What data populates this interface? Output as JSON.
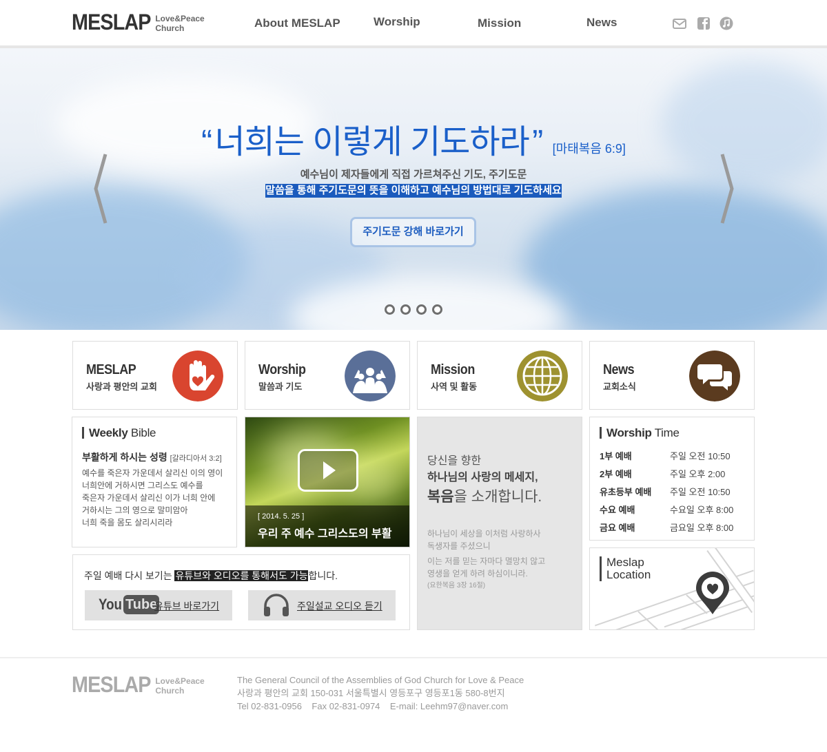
{
  "header": {
    "logo": "MESLAP",
    "logo_sub1": "Love&Peace",
    "logo_sub2": "Church",
    "nav": [
      "About MESLAP",
      "Worship",
      "Mission",
      "News"
    ],
    "social_icons": [
      "mail-icon",
      "facebook-icon",
      "music-icon"
    ]
  },
  "hero": {
    "open_quote": "“",
    "quote": "너희는 이렇게 기도하라",
    "close_quote": "”",
    "reference": "[마태복음 6:9]",
    "line1": "예수님이 제자들에게 직접 가르쳐주신 기도, 주기도문",
    "line2": "말씀을 통해 주기도문의 뜻을 이해하고 예수님의 방법대로 기도하세요",
    "button": "주기도문 강해 바로가기",
    "accent": "#1b5bbd"
  },
  "cards": [
    {
      "title": "MESLAP",
      "subtitle": "사랑과 평안의 교회",
      "icon": "heart-hand-icon",
      "color": "#d9452f"
    },
    {
      "title": "Worship",
      "subtitle": "말씀과 기도",
      "icon": "worship-people-icon",
      "color": "#5a6f98"
    },
    {
      "title": "Mission",
      "subtitle": "사역 및 활동",
      "icon": "globe-icon",
      "color": "#9e9230"
    },
    {
      "title": "News",
      "subtitle": "교회소식",
      "icon": "chat-bubbles-icon",
      "color": "#5b3b1f"
    }
  ],
  "weekly_bible": {
    "title_bold": "Weekly",
    "title_rest": " Bible",
    "heading": "부활하게 하시는 성령",
    "heading_ref": "[갈라디아서 3:2]",
    "lines": [
      "예수를 죽은자 가운데서 살리신 이의 영이",
      "너희안에 거하시면 그리스도 예수를",
      "죽은자 가운데서 살리신 이가 너희 안에",
      "거하시는 그의 영으로 말미암아",
      "너희 죽을 몸도 살리시리라"
    ]
  },
  "video": {
    "date": "[ 2014. 5. 25 ]",
    "title": "우리 주 예수 그리스도의 부활"
  },
  "gospel": {
    "line1": "당신을 향한",
    "line2": "하나님의 사랑의 메세지,",
    "line3_bold": "복음",
    "line3_rest": "을 소개합니다.",
    "verse": [
      "하나님이 세상을 이처럼 사랑하사",
      "독생자를 주셨으니",
      "이는 저를 믿는 자마다 멸망치 않고",
      "영생을 얻게 하려 하심이니라."
    ],
    "verse_ref": "(요한복음 3장 16절)"
  },
  "worship_time": {
    "title_bold": "Worship",
    "title_rest": " Time",
    "rows": [
      {
        "name": "1부 예배",
        "time": "주일 오전 10:50"
      },
      {
        "name": "2부 예배",
        "time": "주일 오후 2:00"
      },
      {
        "name": "유초등부 예배",
        "time": "주일 오전 10:50"
      },
      {
        "name": "수요 예배",
        "time": "수요일 오후 8:00"
      },
      {
        "name": "금요 예배",
        "time": "금요일 오후 8:00"
      }
    ]
  },
  "replay": {
    "text_before": "주일 예배 다시 보기는 ",
    "text_highlight": "유튜브와 오디오를 통해서도 가능",
    "text_after": "합니다.",
    "youtube_logo_you": "You",
    "youtube_logo_tube": "Tube",
    "youtube_label": "유튜브 바로가기",
    "audio_label": "주일설교 오디오 듣기"
  },
  "location": {
    "line1": "Meslap",
    "line2": "Location"
  },
  "footer": {
    "logo": "MESLAP",
    "logo_sub1": "Love&Peace",
    "logo_sub2": "Church",
    "line1": "The General Council of the Assemblies of God Church for Love & Peace",
    "line2": "사랑과 평안의 교회 150-031 서울특별시 영등포구 영등포1동 580-8번지",
    "line3": "Tel 02-831-0956    Fax 02-831-0974    E-mail: Leehm97@naver.com"
  }
}
